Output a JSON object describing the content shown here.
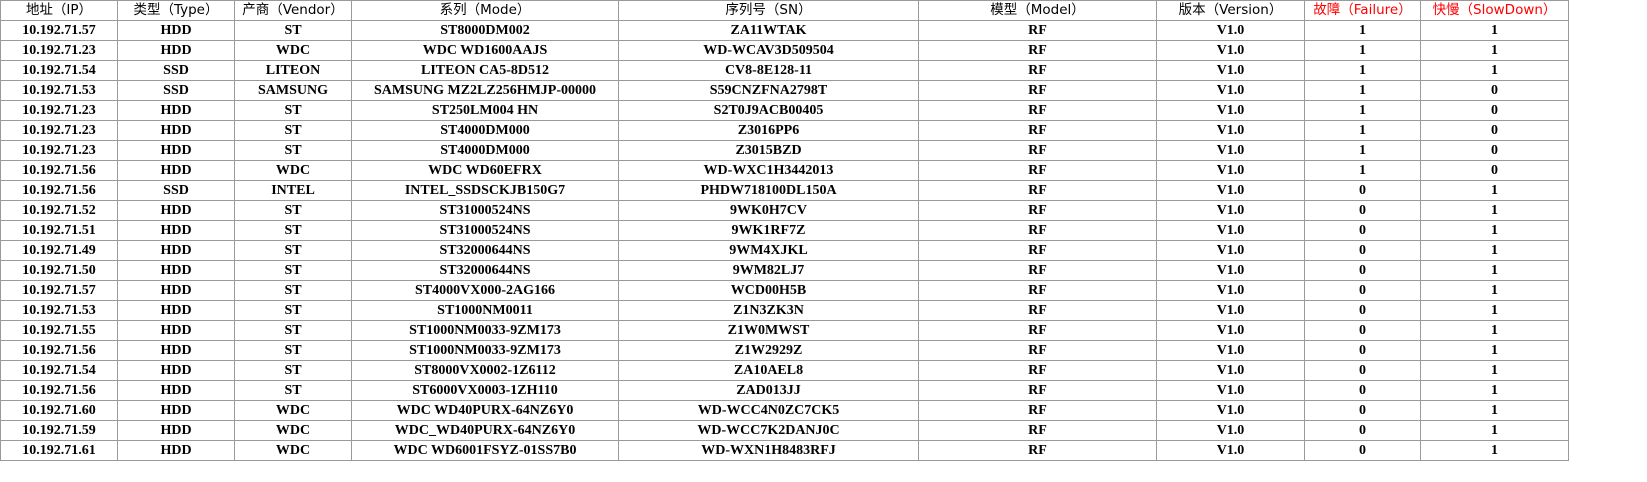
{
  "table": {
    "headers": [
      {
        "label": "地址（IP）",
        "highlight": false
      },
      {
        "label": "类型（Type）",
        "highlight": false
      },
      {
        "label": "产商（Vendor）",
        "highlight": false
      },
      {
        "label": "系列（Mode）",
        "highlight": false
      },
      {
        "label": "序列号（SN）",
        "highlight": false
      },
      {
        "label": "模型（Model）",
        "highlight": false
      },
      {
        "label": "版本（Version）",
        "highlight": false
      },
      {
        "label": "故障（Failure）",
        "highlight": true
      },
      {
        "label": "快慢（SlowDown）",
        "highlight": true
      }
    ],
    "rows": [
      [
        "10.192.71.57",
        "HDD",
        "ST",
        "ST8000DM002",
        "ZA11WTAK",
        "RF",
        "V1.0",
        "1",
        "1"
      ],
      [
        "10.192.71.23",
        "HDD",
        "WDC",
        "WDC WD1600AAJS",
        "WD-WCAV3D509504",
        "RF",
        "V1.0",
        "1",
        "1"
      ],
      [
        "10.192.71.54",
        "SSD",
        "LITEON",
        "LITEON CA5-8D512",
        "CV8-8E128-11",
        "RF",
        "V1.0",
        "1",
        "1"
      ],
      [
        "10.192.71.53",
        "SSD",
        "SAMSUNG",
        "SAMSUNG MZ2LZ256HMJP-00000",
        "S59CNZFNA2798T",
        "RF",
        "V1.0",
        "1",
        "0"
      ],
      [
        "10.192.71.23",
        "HDD",
        "ST",
        "ST250LM004 HN",
        "S2T0J9ACB00405",
        "RF",
        "V1.0",
        "1",
        "0"
      ],
      [
        "10.192.71.23",
        "HDD",
        "ST",
        "ST4000DM000",
        "Z3016PP6",
        "RF",
        "V1.0",
        "1",
        "0"
      ],
      [
        "10.192.71.23",
        "HDD",
        "ST",
        "ST4000DM000",
        "Z3015BZD",
        "RF",
        "V1.0",
        "1",
        "0"
      ],
      [
        "10.192.71.56",
        "HDD",
        "WDC",
        "WDC WD60EFRX",
        "WD-WXC1H3442013",
        "RF",
        "V1.0",
        "1",
        "0"
      ],
      [
        "10.192.71.56",
        "SSD",
        "INTEL",
        "INTEL_SSDSCKJB150G7",
        "PHDW718100DL150A",
        "RF",
        "V1.0",
        "0",
        "1"
      ],
      [
        "10.192.71.52",
        "HDD",
        "ST",
        "ST31000524NS",
        "9WK0H7CV",
        "RF",
        "V1.0",
        "0",
        "1"
      ],
      [
        "10.192.71.51",
        "HDD",
        "ST",
        "ST31000524NS",
        "9WK1RF7Z",
        "RF",
        "V1.0",
        "0",
        "1"
      ],
      [
        "10.192.71.49",
        "HDD",
        "ST",
        "ST32000644NS",
        "9WM4XJKL",
        "RF",
        "V1.0",
        "0",
        "1"
      ],
      [
        "10.192.71.50",
        "HDD",
        "ST",
        "ST32000644NS",
        "9WM82LJ7",
        "RF",
        "V1.0",
        "0",
        "1"
      ],
      [
        "10.192.71.57",
        "HDD",
        "ST",
        "ST4000VX000-2AG166",
        "WCD00H5B",
        "RF",
        "V1.0",
        "0",
        "1"
      ],
      [
        "10.192.71.53",
        "HDD",
        "ST",
        "ST1000NM0011",
        "Z1N3ZK3N",
        "RF",
        "V1.0",
        "0",
        "1"
      ],
      [
        "10.192.71.55",
        "HDD",
        "ST",
        "ST1000NM0033-9ZM173",
        "Z1W0MWST",
        "RF",
        "V1.0",
        "0",
        "1"
      ],
      [
        "10.192.71.56",
        "HDD",
        "ST",
        "ST1000NM0033-9ZM173",
        "Z1W2929Z",
        "RF",
        "V1.0",
        "0",
        "1"
      ],
      [
        "10.192.71.54",
        "HDD",
        "ST",
        "ST8000VX0002-1Z6112",
        "ZA10AEL8",
        "RF",
        "V1.0",
        "0",
        "1"
      ],
      [
        "10.192.71.56",
        "HDD",
        "ST",
        "ST6000VX0003-1ZH110",
        "ZAD013JJ",
        "RF",
        "V1.0",
        "0",
        "1"
      ],
      [
        "10.192.71.60",
        "HDD",
        "WDC",
        "WDC WD40PURX-64NZ6Y0",
        "WD-WCC4N0ZC7CK5",
        "RF",
        "V1.0",
        "0",
        "1"
      ],
      [
        "10.192.71.59",
        "HDD",
        "WDC",
        "WDC_WD40PURX-64NZ6Y0",
        "WD-WCC7K2DANJ0C",
        "RF",
        "V1.0",
        "0",
        "1"
      ],
      [
        "10.192.71.61",
        "HDD",
        "WDC",
        "WDC WD6001FSYZ-01SS7B0",
        "WD-WXN1H8483RFJ",
        "RF",
        "V1.0",
        "0",
        "1"
      ]
    ]
  },
  "colors": {
    "header_text": "#000000",
    "highlight_header_text": "#ff0000",
    "grid_line": "#9a9a9a",
    "background": "#ffffff"
  }
}
